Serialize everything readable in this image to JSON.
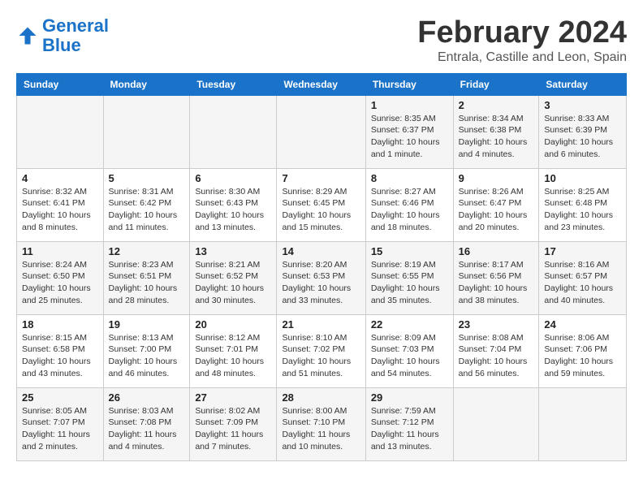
{
  "header": {
    "logo_line1": "General",
    "logo_line2": "Blue",
    "month": "February 2024",
    "location": "Entrala, Castille and Leon, Spain"
  },
  "weekdays": [
    "Sunday",
    "Monday",
    "Tuesday",
    "Wednesday",
    "Thursday",
    "Friday",
    "Saturday"
  ],
  "weeks": [
    [
      {
        "day": "",
        "info": ""
      },
      {
        "day": "",
        "info": ""
      },
      {
        "day": "",
        "info": ""
      },
      {
        "day": "",
        "info": ""
      },
      {
        "day": "1",
        "info": "Sunrise: 8:35 AM\nSunset: 6:37 PM\nDaylight: 10 hours\nand 1 minute."
      },
      {
        "day": "2",
        "info": "Sunrise: 8:34 AM\nSunset: 6:38 PM\nDaylight: 10 hours\nand 4 minutes."
      },
      {
        "day": "3",
        "info": "Sunrise: 8:33 AM\nSunset: 6:39 PM\nDaylight: 10 hours\nand 6 minutes."
      }
    ],
    [
      {
        "day": "4",
        "info": "Sunrise: 8:32 AM\nSunset: 6:41 PM\nDaylight: 10 hours\nand 8 minutes."
      },
      {
        "day": "5",
        "info": "Sunrise: 8:31 AM\nSunset: 6:42 PM\nDaylight: 10 hours\nand 11 minutes."
      },
      {
        "day": "6",
        "info": "Sunrise: 8:30 AM\nSunset: 6:43 PM\nDaylight: 10 hours\nand 13 minutes."
      },
      {
        "day": "7",
        "info": "Sunrise: 8:29 AM\nSunset: 6:45 PM\nDaylight: 10 hours\nand 15 minutes."
      },
      {
        "day": "8",
        "info": "Sunrise: 8:27 AM\nSunset: 6:46 PM\nDaylight: 10 hours\nand 18 minutes."
      },
      {
        "day": "9",
        "info": "Sunrise: 8:26 AM\nSunset: 6:47 PM\nDaylight: 10 hours\nand 20 minutes."
      },
      {
        "day": "10",
        "info": "Sunrise: 8:25 AM\nSunset: 6:48 PM\nDaylight: 10 hours\nand 23 minutes."
      }
    ],
    [
      {
        "day": "11",
        "info": "Sunrise: 8:24 AM\nSunset: 6:50 PM\nDaylight: 10 hours\nand 25 minutes."
      },
      {
        "day": "12",
        "info": "Sunrise: 8:23 AM\nSunset: 6:51 PM\nDaylight: 10 hours\nand 28 minutes."
      },
      {
        "day": "13",
        "info": "Sunrise: 8:21 AM\nSunset: 6:52 PM\nDaylight: 10 hours\nand 30 minutes."
      },
      {
        "day": "14",
        "info": "Sunrise: 8:20 AM\nSunset: 6:53 PM\nDaylight: 10 hours\nand 33 minutes."
      },
      {
        "day": "15",
        "info": "Sunrise: 8:19 AM\nSunset: 6:55 PM\nDaylight: 10 hours\nand 35 minutes."
      },
      {
        "day": "16",
        "info": "Sunrise: 8:17 AM\nSunset: 6:56 PM\nDaylight: 10 hours\nand 38 minutes."
      },
      {
        "day": "17",
        "info": "Sunrise: 8:16 AM\nSunset: 6:57 PM\nDaylight: 10 hours\nand 40 minutes."
      }
    ],
    [
      {
        "day": "18",
        "info": "Sunrise: 8:15 AM\nSunset: 6:58 PM\nDaylight: 10 hours\nand 43 minutes."
      },
      {
        "day": "19",
        "info": "Sunrise: 8:13 AM\nSunset: 7:00 PM\nDaylight: 10 hours\nand 46 minutes."
      },
      {
        "day": "20",
        "info": "Sunrise: 8:12 AM\nSunset: 7:01 PM\nDaylight: 10 hours\nand 48 minutes."
      },
      {
        "day": "21",
        "info": "Sunrise: 8:10 AM\nSunset: 7:02 PM\nDaylight: 10 hours\nand 51 minutes."
      },
      {
        "day": "22",
        "info": "Sunrise: 8:09 AM\nSunset: 7:03 PM\nDaylight: 10 hours\nand 54 minutes."
      },
      {
        "day": "23",
        "info": "Sunrise: 8:08 AM\nSunset: 7:04 PM\nDaylight: 10 hours\nand 56 minutes."
      },
      {
        "day": "24",
        "info": "Sunrise: 8:06 AM\nSunset: 7:06 PM\nDaylight: 10 hours\nand 59 minutes."
      }
    ],
    [
      {
        "day": "25",
        "info": "Sunrise: 8:05 AM\nSunset: 7:07 PM\nDaylight: 11 hours\nand 2 minutes."
      },
      {
        "day": "26",
        "info": "Sunrise: 8:03 AM\nSunset: 7:08 PM\nDaylight: 11 hours\nand 4 minutes."
      },
      {
        "day": "27",
        "info": "Sunrise: 8:02 AM\nSunset: 7:09 PM\nDaylight: 11 hours\nand 7 minutes."
      },
      {
        "day": "28",
        "info": "Sunrise: 8:00 AM\nSunset: 7:10 PM\nDaylight: 11 hours\nand 10 minutes."
      },
      {
        "day": "29",
        "info": "Sunrise: 7:59 AM\nSunset: 7:12 PM\nDaylight: 11 hours\nand 13 minutes."
      },
      {
        "day": "",
        "info": ""
      },
      {
        "day": "",
        "info": ""
      }
    ]
  ]
}
